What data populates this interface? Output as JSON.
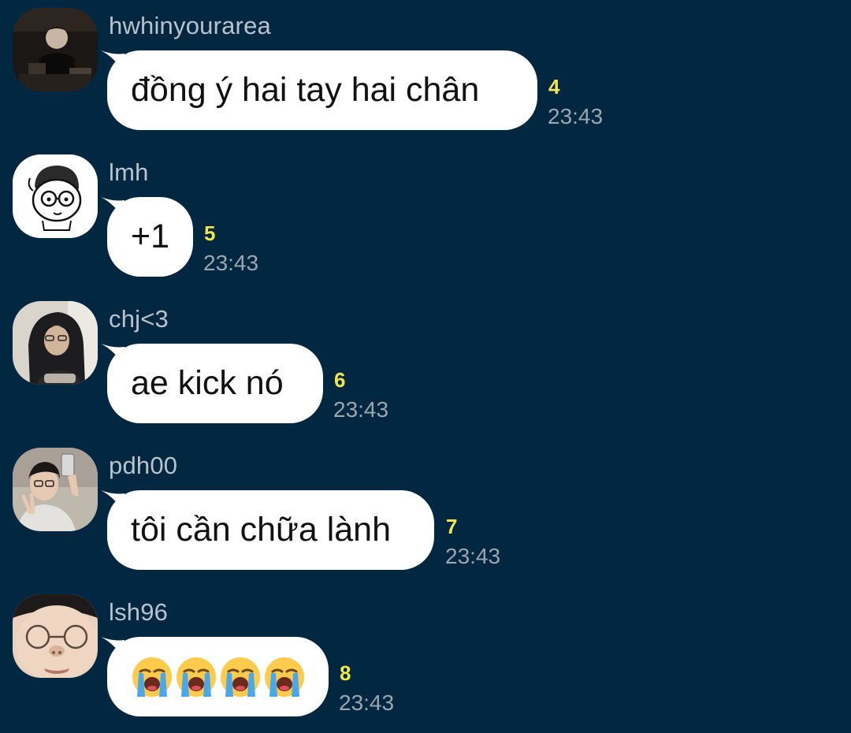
{
  "messages": [
    {
      "sender": "hwhinyourarea",
      "text": "đồng ý hai tay hai chân",
      "unread": "4",
      "time": "23:43",
      "avatar": "avatar-photo-man-dark-room"
    },
    {
      "sender": "lmh",
      "text": "+1",
      "unread": "5",
      "time": "23:43",
      "avatar": "avatar-cartoon-boy-glasses"
    },
    {
      "sender": "chj<3",
      "text": "ae kick nó",
      "unread": "6",
      "time": "23:43",
      "avatar": "avatar-photo-hooded-person"
    },
    {
      "sender": "pdh00",
      "text": "tôi cần chữa lành",
      "unread": "7",
      "time": "23:43",
      "avatar": "avatar-photo-selfie-peace"
    },
    {
      "sender": "lsh96",
      "text": "😭😭😭😭",
      "unread": "8",
      "time": "23:43",
      "avatar": "avatar-photo-face-glasses"
    }
  ],
  "colors": {
    "background": "#022741",
    "bubble": "#ffffff",
    "sender": "#b9c3cc",
    "unread": "#f2e64a",
    "time": "#9aa6b0"
  }
}
